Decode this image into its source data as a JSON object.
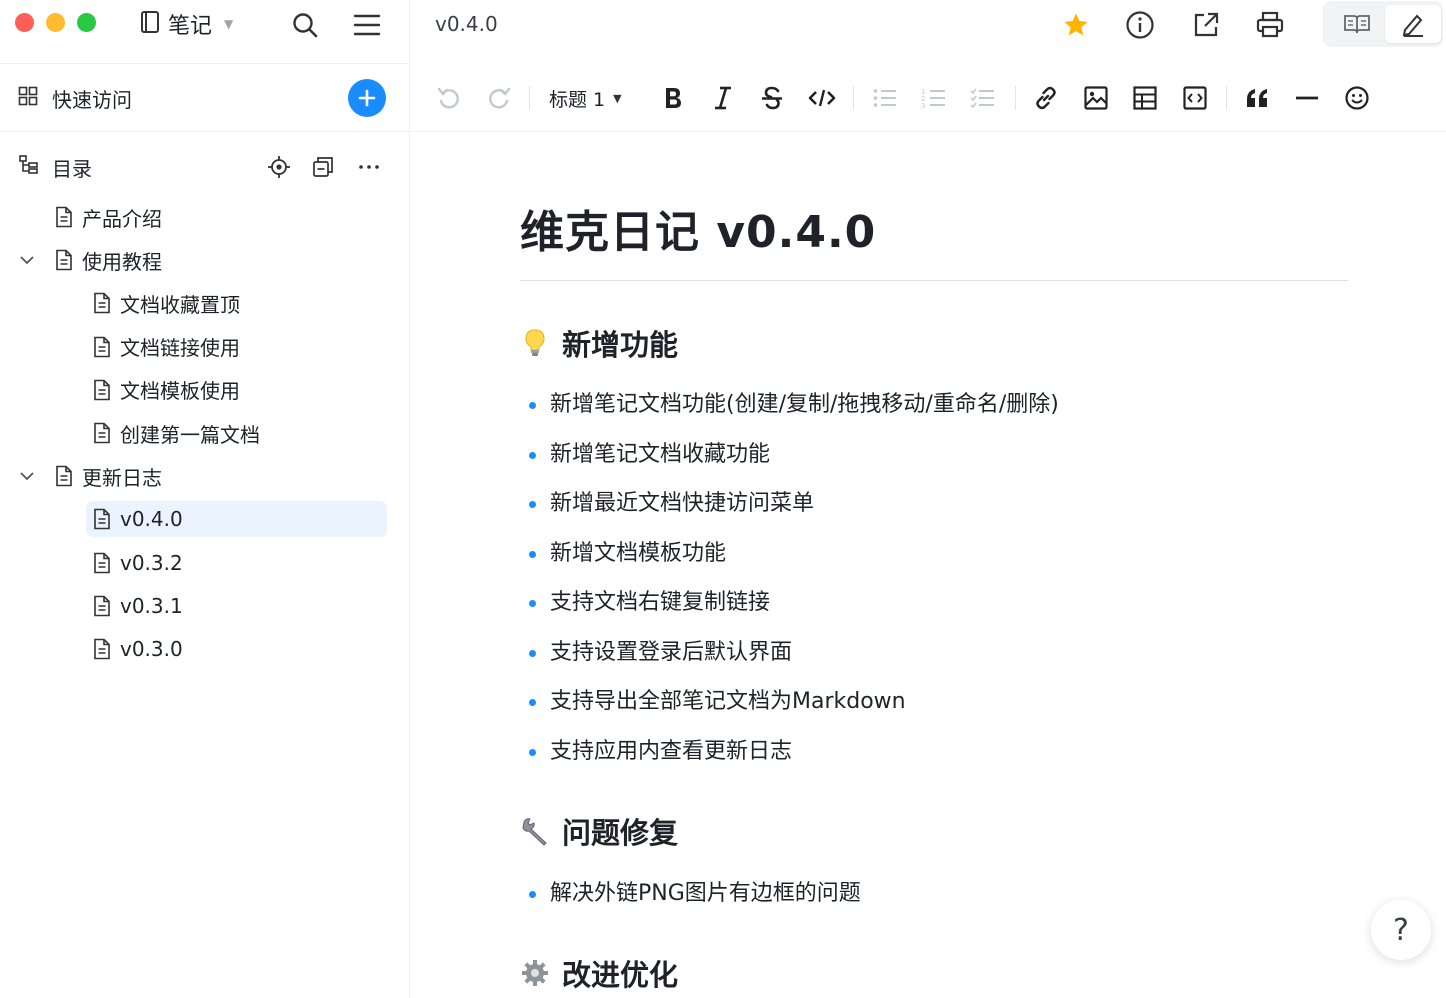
{
  "window": {
    "notebook_label": "笔记"
  },
  "sidebar": {
    "quick_access_label": "快速访问",
    "toc_label": "目录",
    "tree": [
      {
        "label": "产品介绍",
        "level": 1,
        "expanded": null,
        "active": false
      },
      {
        "label": "使用教程",
        "level": 1,
        "expanded": true,
        "active": false
      },
      {
        "label": "文档收藏置顶",
        "level": 2,
        "expanded": null,
        "active": false
      },
      {
        "label": "文档链接使用",
        "level": 2,
        "expanded": null,
        "active": false
      },
      {
        "label": "文档模板使用",
        "level": 2,
        "expanded": null,
        "active": false
      },
      {
        "label": "创建第一篇文档",
        "level": 2,
        "expanded": null,
        "active": false
      },
      {
        "label": "更新日志",
        "level": 1,
        "expanded": true,
        "active": false
      },
      {
        "label": "v0.4.0",
        "level": 2,
        "expanded": null,
        "active": true
      },
      {
        "label": "v0.3.2",
        "level": 2,
        "expanded": null,
        "active": false
      },
      {
        "label": "v0.3.1",
        "level": 2,
        "expanded": null,
        "active": false
      },
      {
        "label": "v0.3.0",
        "level": 2,
        "expanded": null,
        "active": false
      }
    ]
  },
  "topbar": {
    "doc_tab": "v0.4.0",
    "favorite_starred": true,
    "mode": "edit"
  },
  "toolbar": {
    "heading_select": "标题 1"
  },
  "document": {
    "title": "维克日记 v0.4.0",
    "sections": [
      {
        "heading": "新增功能",
        "emoji": "lightbulb-icon",
        "items": [
          "新增笔记文档功能(创建/复制/拖拽移动/重命名/删除)",
          "新增笔记文档收藏功能",
          "新增最近文档快捷访问菜单",
          "新增文档模板功能",
          "支持文档右键复制链接",
          "支持设置登录后默认界面",
          "支持导出全部笔记文档为Markdown",
          "支持应用内查看更新日志"
        ]
      },
      {
        "heading": "问题修复",
        "emoji": "wrench-icon",
        "items": [
          "解决外链PNG图片有边框的问题"
        ]
      },
      {
        "heading": "改进优化",
        "emoji": "gear-icon",
        "items": []
      }
    ]
  },
  "help": {
    "label": "?"
  },
  "colors": {
    "accent": "#1a8cff",
    "star": "#ffb400",
    "active_bg": "#eaf3ff",
    "text": "#1f2329",
    "divider": "#eef0f3"
  }
}
